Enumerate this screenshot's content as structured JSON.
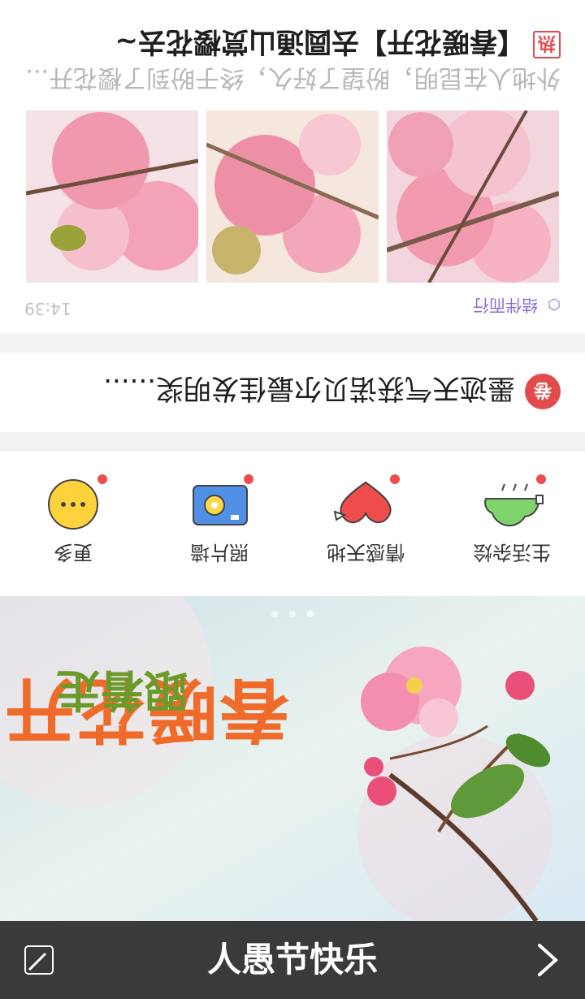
{
  "top_card": {
    "topic_tag": "结伴而行",
    "time": "14:39",
    "hot_badge": "热",
    "headline": "【春暖花开】去圆通山赏樱花去~",
    "excerpt": "外地人在昆明，盼望了好久，终于盼到了樱花开..."
  },
  "news": {
    "icon_label": "卷",
    "text": "墨迹天气获诺贝尔最佳发明奖......"
  },
  "categories": [
    {
      "label": "生活杂烩",
      "icon": "cloud-rain-icon"
    },
    {
      "label": "情感天地",
      "icon": "heart-icon"
    },
    {
      "label": "照片墙",
      "icon": "camera-box-icon"
    },
    {
      "label": "更多",
      "icon": "more-dots-icon"
    }
  ],
  "banner": {
    "line1": "跟着走",
    "line2": "春暖花开"
  },
  "bottom_bar": {
    "title": "人愚节快乐"
  },
  "colors": {
    "accent_red": "#e14b4b",
    "tag_purple": "#8a6ad6",
    "bar_dark": "#3a3a3a"
  }
}
